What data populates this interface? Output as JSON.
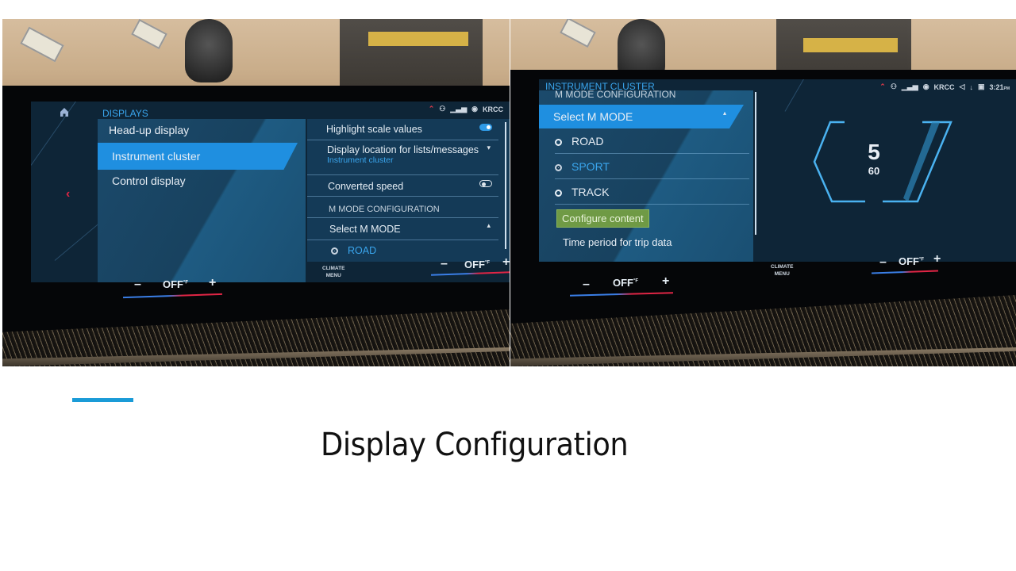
{
  "slide": {
    "title": "Display Configuration",
    "accent_color": "#1a9bd7"
  },
  "left_photo": {
    "status_bar": {
      "icons": [
        "warning-icon",
        "connected-icon",
        "signal-icon",
        "radio-icon"
      ],
      "station": "KRCC"
    },
    "section_title": "DISPLAYS",
    "menu_items": [
      {
        "label": "Head-up display",
        "selected": false
      },
      {
        "label": "Instrument cluster",
        "selected": true
      },
      {
        "label": "Control display",
        "selected": false
      }
    ],
    "settings": {
      "highlight_scale_values": {
        "label": "Highlight scale values",
        "toggle": "on"
      },
      "display_location": {
        "label": "Display location for lists/messages",
        "value": "Instrument cluster"
      },
      "converted_speed": {
        "label": "Converted speed",
        "toggle": "off"
      },
      "m_mode_header": "M MODE CONFIGURATION",
      "select_m_mode": "Select M MODE",
      "selected_option": "ROAD"
    },
    "climate": {
      "minus": "–",
      "value": "OFF",
      "unit": "°F",
      "plus": "+",
      "menu_line1": "CLIMATE",
      "menu_line2": "MENU"
    },
    "right_climate": {
      "minus": "–",
      "value": "OFF",
      "unit": "°F",
      "plus": "+"
    }
  },
  "right_photo": {
    "status_bar": {
      "station": "KRCC",
      "time": "3:21",
      "ampm": "PM"
    },
    "section_title": "INSTRUMENT CLUSTER",
    "m_mode_header": "M MODE CONFIGURATION",
    "select_m_mode": "Select M MODE",
    "options": [
      {
        "label": "ROAD",
        "selected": false
      },
      {
        "label": "SPORT",
        "selected": true
      },
      {
        "label": "TRACK",
        "selected": false
      }
    ],
    "configure_button": "Configure content",
    "next_item": "Time period for trip data",
    "cluster_preview": {
      "gear": "5",
      "speed": "60"
    },
    "climate_left": {
      "minus": "–",
      "value": "OFF",
      "unit": "°F",
      "plus": "+"
    },
    "climate_menu_line1": "CLIMATE",
    "climate_menu_line2": "MENU",
    "climate_right": {
      "minus": "–",
      "value": "OFF",
      "unit": "°F",
      "plus": "+"
    }
  }
}
